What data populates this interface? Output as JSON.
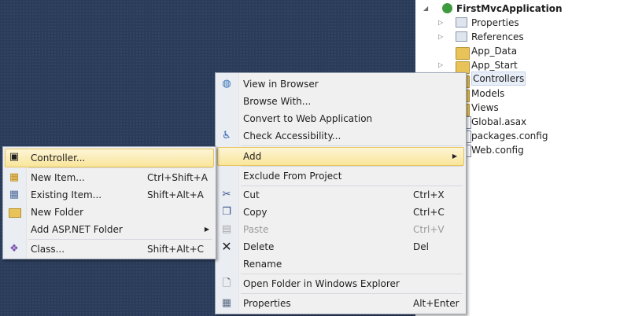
{
  "solution_explorer": {
    "project": "FirstMvcApplication",
    "items": [
      {
        "label": "Properties"
      },
      {
        "label": "References"
      },
      {
        "label": "App_Data"
      },
      {
        "label": "App_Start"
      },
      {
        "label": "Controllers"
      },
      {
        "label": "Models"
      },
      {
        "label": "Views"
      },
      {
        "label": "Global.asax"
      },
      {
        "label": "packages.config"
      },
      {
        "label": "Web.config"
      }
    ]
  },
  "context_menu": {
    "items": [
      {
        "label": "View in Browser",
        "shortcut": ""
      },
      {
        "label": "Browse With...",
        "shortcut": ""
      },
      {
        "label": "Convert to Web Application",
        "shortcut": ""
      },
      {
        "label": "Check Accessibility...",
        "shortcut": ""
      },
      {
        "label": "Add",
        "shortcut": ""
      },
      {
        "label": "Exclude From Project",
        "shortcut": ""
      },
      {
        "label": "Cut",
        "shortcut": "Ctrl+X"
      },
      {
        "label": "Copy",
        "shortcut": "Ctrl+C"
      },
      {
        "label": "Paste",
        "shortcut": "Ctrl+V"
      },
      {
        "label": "Delete",
        "shortcut": "Del"
      },
      {
        "label": "Rename",
        "shortcut": ""
      },
      {
        "label": "Open Folder in Windows Explorer",
        "shortcut": ""
      },
      {
        "label": "Properties",
        "shortcut": "Alt+Enter"
      }
    ]
  },
  "add_submenu": {
    "items": [
      {
        "label": "Controller...",
        "shortcut": ""
      },
      {
        "label": "New Item...",
        "shortcut": "Ctrl+Shift+A"
      },
      {
        "label": "Existing Item...",
        "shortcut": "Shift+Alt+A"
      },
      {
        "label": "New Folder",
        "shortcut": ""
      },
      {
        "label": "Add ASP.NET Folder",
        "shortcut": ""
      },
      {
        "label": "Class...",
        "shortcut": "Shift+Alt+C"
      }
    ]
  },
  "colors": {
    "highlight": "#f9e59a",
    "background": "#2b3c59",
    "menu": "#f0f0f0"
  }
}
